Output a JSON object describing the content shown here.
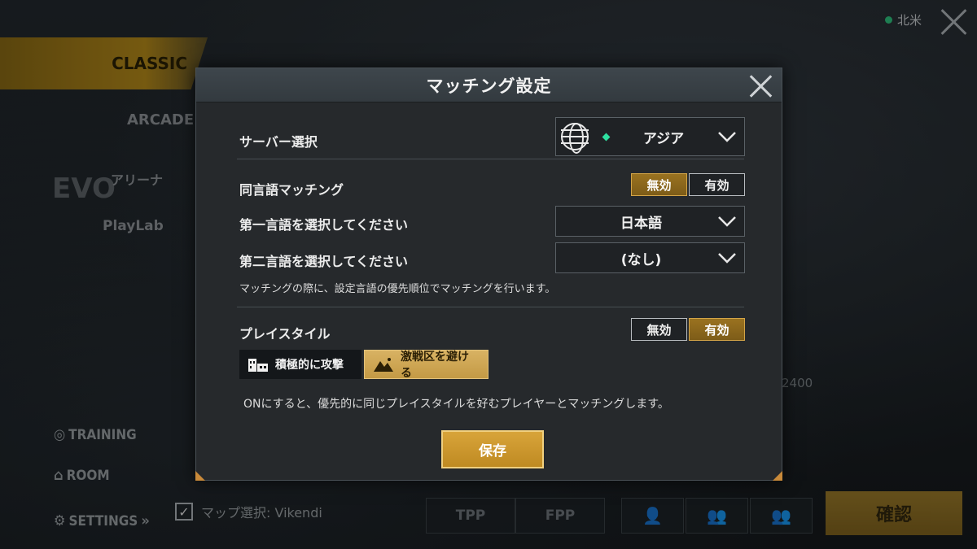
{
  "background": {
    "modes": {
      "classic": "CLASSIC",
      "arcade": "ARCADE",
      "evo": "EVO",
      "arena": "アリーナ",
      "playlab": "PlayLab"
    },
    "side_menu": {
      "training": "TRAINING",
      "room": "ROOM",
      "settings": "SETTINGS"
    },
    "region": "北米",
    "map_select": "マップ選択: Vikendi",
    "perspective_tabs": [
      "TPP",
      "FPP"
    ],
    "squad_icons": [
      "solo-icon",
      "duo-icon",
      "squad-icon"
    ],
    "confirm_label": "確認",
    "score_text": "2400"
  },
  "dialog": {
    "title": "マッチング設定",
    "server": {
      "label": "サーバー選択",
      "value": "アジア",
      "status_color": "#2ee0a0"
    },
    "same_language": {
      "label": "同言語マッチング",
      "options": [
        "無効",
        "有効"
      ],
      "selected": "無効"
    },
    "first_language": {
      "label": "第一言語を選択してください",
      "value": "日本語"
    },
    "second_language": {
      "label": "第二言語を選択してください",
      "value": "(なし)"
    },
    "language_note": "マッチングの際に、設定言語の優先順位でマッチングを行います。",
    "playstyle": {
      "label": "プレイスタイル",
      "options": [
        "無効",
        "有効"
      ],
      "selected": "有効",
      "styles": [
        {
          "label": "積極的に攻撃",
          "icon": "building-icon",
          "selected": false
        },
        {
          "label": "激戦区を避ける",
          "icon": "mountain-icon",
          "selected": true
        }
      ]
    },
    "playstyle_note": "ONにすると、優先的に同じプレイスタイルを好むプレイヤーとマッチングします。",
    "save_label": "保存",
    "accent_color": "#c49a45"
  }
}
